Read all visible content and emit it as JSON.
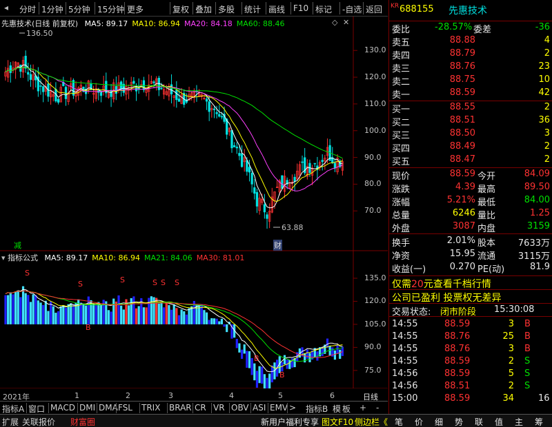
{
  "toolbar": {
    "items": [
      "分时",
      "1分钟",
      "5分钟",
      "15分钟",
      "更多",
      "复权",
      "叠加",
      "多股",
      "统计",
      "画线",
      "F10",
      "标记",
      "-自选",
      "返回"
    ]
  },
  "main_chart": {
    "title": "先惠技术(日线 前复权)",
    "ma": [
      {
        "label": "MA5: 89.17",
        "color": "#ffffff"
      },
      {
        "label": "MA10: 86.94",
        "color": "#ffff00"
      },
      {
        "label": "MA20: 84.18",
        "color": "#ff40ff"
      },
      {
        "label": "MA60: 88.46",
        "color": "#00e000"
      }
    ],
    "yticks": [
      "130.0",
      "120.0",
      "110.0",
      "100.0",
      "90.0",
      "80.0",
      "70.0"
    ],
    "high_mark": "136.50",
    "low_mark": "63.88",
    "jian_label": "减",
    "cai_label": "财"
  },
  "indicator": {
    "title": "指标公式",
    "ma": [
      {
        "label": "MA5: 89.17",
        "color": "#ffffff"
      },
      {
        "label": "MA10: 86.94",
        "color": "#ffff00"
      },
      {
        "label": "MA21: 84.06",
        "color": "#00e000"
      },
      {
        "label": "MA30: 81.01",
        "color": "#ff3232"
      }
    ],
    "yticks": [
      "135.0",
      "120.0",
      "105.0",
      "90.0",
      "75.0"
    ],
    "s_label": "S",
    "b_label": "B"
  },
  "xaxis": {
    "year": "2021年",
    "months": [
      "1",
      "2",
      "3",
      "4",
      "5",
      "6"
    ],
    "unit": "日线"
  },
  "bottom_tabs": [
    "指标A",
    "窗口",
    "MACD",
    "DMI",
    "DMA",
    "FSL",
    "TRIX",
    "BRAR",
    "CR",
    "VR",
    "OBV",
    "ASI",
    "EMV",
    ">",
    "指标B",
    "模",
    "板",
    "+",
    "-"
  ],
  "status": {
    "left": [
      "扩展",
      "关联报价",
      "财富圈"
    ],
    "right": [
      "新用户福利专享",
      "图文F10",
      "侧边栏《"
    ],
    "icons": [
      "笔",
      "价",
      "细",
      "势",
      "联",
      "值",
      "主",
      "筹"
    ]
  },
  "stock": {
    "code": "688155",
    "name": "先惠技术",
    "tag": "KR"
  },
  "weibi": {
    "label": "委比",
    "value": "-28.57%",
    "diff_label": "委差",
    "diff": "-36"
  },
  "asks": [
    {
      "label": "卖五",
      "price": "88.88",
      "vol": "4"
    },
    {
      "label": "卖四",
      "price": "88.79",
      "vol": "2"
    },
    {
      "label": "卖三",
      "price": "88.76",
      "vol": "23"
    },
    {
      "label": "卖二",
      "price": "88.75",
      "vol": "10"
    },
    {
      "label": "卖一",
      "price": "88.59",
      "vol": "42"
    }
  ],
  "bids": [
    {
      "label": "买一",
      "price": "88.55",
      "vol": "2"
    },
    {
      "label": "买二",
      "price": "88.51",
      "vol": "36"
    },
    {
      "label": "买三",
      "price": "88.50",
      "vol": "3"
    },
    {
      "label": "买四",
      "price": "88.49",
      "vol": "2"
    },
    {
      "label": "买五",
      "price": "88.47",
      "vol": "2"
    }
  ],
  "quote": [
    {
      "l1": "现价",
      "v1": "88.59",
      "c1": "red",
      "l2": "今开",
      "v2": "84.09",
      "c2": "red"
    },
    {
      "l1": "涨跌",
      "v1": "4.39",
      "c1": "red",
      "l2": "最高",
      "v2": "89.50",
      "c2": "red"
    },
    {
      "l1": "涨幅",
      "v1": "5.21%",
      "c1": "red",
      "l2": "最低",
      "v2": "84.00",
      "c2": "grn"
    },
    {
      "l1": "总量",
      "v1": "6246",
      "c1": "yel",
      "l2": "量比",
      "v2": "1.25",
      "c2": "red"
    },
    {
      "l1": "外盘",
      "v1": "3087",
      "c1": "red",
      "l2": "内盘",
      "v2": "3159",
      "c2": "grn"
    }
  ],
  "stats": [
    {
      "l1": "换手",
      "v1": "2.01%",
      "l2": "股本",
      "v2": "7633万"
    },
    {
      "l1": "净资",
      "v1": "15.95",
      "l2": "流通",
      "v2": "3115万"
    },
    {
      "l1": "收益(一)",
      "v1": "0.270",
      "l2": "PE(动)",
      "v2": "81.9"
    }
  ],
  "promo": {
    "prefix": "仅需",
    "highlight": "20",
    "suffix": "元查看千档行情"
  },
  "notice": "公司已盈利 投票权无差异",
  "trade_status": {
    "label": "交易状态:",
    "value": "闭市阶段",
    "time": "15:30:08"
  },
  "ticks": [
    {
      "time": "14:55",
      "price": "88.59",
      "vol": "3",
      "side": "B"
    },
    {
      "time": "14:55",
      "price": "88.76",
      "vol": "25",
      "side": "B"
    },
    {
      "time": "14:55",
      "price": "88.76",
      "vol": "3",
      "side": "B"
    },
    {
      "time": "14:55",
      "price": "88.59",
      "vol": "2",
      "side": "S"
    },
    {
      "time": "14:56",
      "price": "88.59",
      "vol": "5",
      "side": "S"
    },
    {
      "time": "14:56",
      "price": "88.51",
      "vol": "2",
      "side": "S"
    },
    {
      "time": "15:00",
      "price": "88.59",
      "vol": "34",
      "side": "",
      "extra": "16"
    }
  ],
  "colors": {
    "up": "#ff3232",
    "down": "#00e0e0",
    "grid": "#7a0000"
  }
}
